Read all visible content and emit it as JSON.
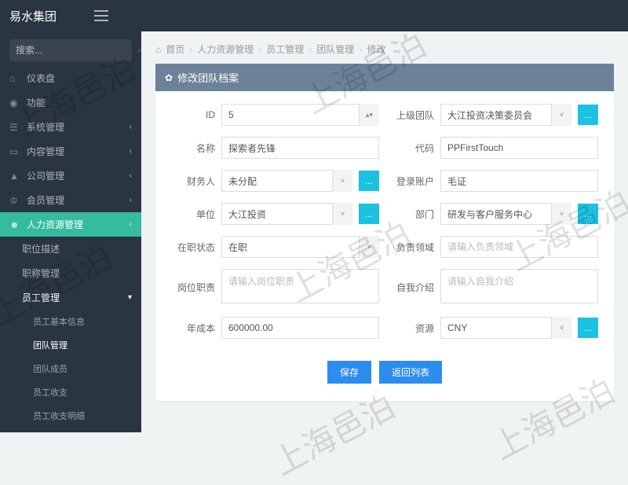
{
  "brand": "易水集团",
  "search": {
    "placeholder": "搜索..."
  },
  "sidebar": {
    "items": [
      {
        "label": "仪表盘"
      },
      {
        "label": "功能"
      },
      {
        "label": "系统管理"
      },
      {
        "label": "内容管理"
      },
      {
        "label": "公司管理"
      },
      {
        "label": "会员管理"
      },
      {
        "label": "人力资源管理"
      }
    ],
    "subs": [
      {
        "label": "职位描述"
      },
      {
        "label": "职称管理"
      },
      {
        "label": "员工管理"
      }
    ],
    "subs2": [
      {
        "label": "员工基本信息"
      },
      {
        "label": "团队管理"
      },
      {
        "label": "团队成员"
      },
      {
        "label": "员工收支"
      },
      {
        "label": "员工收支明细"
      }
    ]
  },
  "breadcrumb": {
    "items": [
      "首页",
      "人力资源管理",
      "员工管理",
      "团队管理",
      "修改"
    ]
  },
  "panel": {
    "title": "修改团队档案"
  },
  "form": {
    "id_label": "ID",
    "id_value": "5",
    "parent_team_label": "上级团队",
    "parent_team_value": "大江投资决策委员会",
    "name_label": "名称",
    "name_value": "探索者先锋",
    "code_label": "代码",
    "code_value": "PPFirstTouch",
    "finance_label": "财务人",
    "finance_value": "未分配",
    "login_label": "登录账户",
    "login_value": "毛证",
    "unit_label": "单位",
    "unit_value": "大江投资",
    "dept_label": "部门",
    "dept_value": "研发与客户服务中心",
    "status_label": "在职状态",
    "status_value": "在职",
    "duty_area_label": "负责领域",
    "duty_area_placeholder": "请输入负责领域",
    "job_desc_label": "岗位职责",
    "job_desc_placeholder": "请输入岗位职责",
    "self_intro_label": "自我介绍",
    "self_intro_placeholder": "请输入自我介绍",
    "annual_cost_label": "年成本",
    "annual_cost_value": "600000.00",
    "currency_label": "资源",
    "currency_value": "CNY"
  },
  "buttons": {
    "save": "保存",
    "back": "返回列表",
    "ext": "..."
  },
  "watermark": "上海邑泊"
}
